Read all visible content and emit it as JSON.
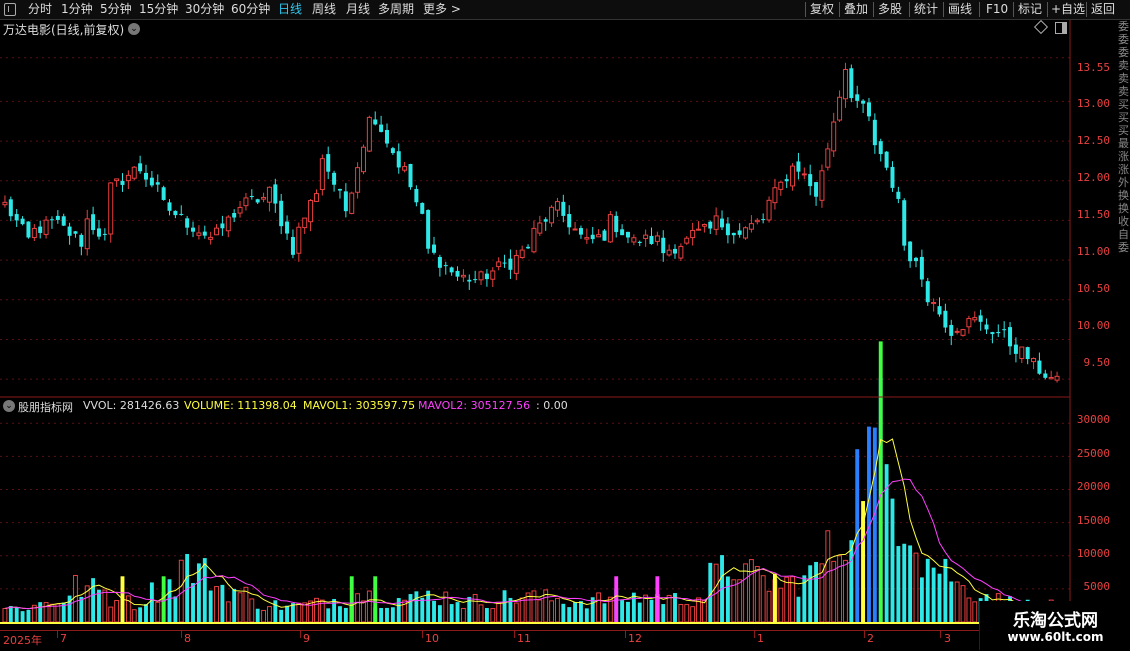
{
  "toolbar": {
    "left": [
      "分时",
      "1分钟",
      "5分钟",
      "15分钟",
      "30分钟",
      "60分钟",
      "日线",
      "周线",
      "月线",
      "多周期",
      "更多 >"
    ],
    "active": "日线",
    "right": [
      "复权",
      "叠加",
      "多股",
      "统计",
      "画线",
      "F10",
      "标记",
      "+自选",
      "返回"
    ]
  },
  "stock_title": "万达电影(日线,前复权)",
  "price_axis": [
    "13.55",
    "13.00",
    "12.50",
    "12.00",
    "11.50",
    "11.00",
    "10.50",
    "10.00",
    "9.50"
  ],
  "volume_axis": [
    "30000",
    "25000",
    "20000",
    "15000",
    "10000",
    "5000"
  ],
  "volume_header": {
    "name": "股朋指标网",
    "vvol": "VVOL: 281426.63",
    "volume": "VOLUME: 111398.04",
    "mavol1": "MAVOL1: 303597.75",
    "mavol2": "MAVOL2: 305127.56",
    "extra": ": 0.00"
  },
  "date_axis": [
    "2025年",
    "7",
    "8",
    "9",
    "10",
    "11",
    "12",
    "1",
    "2",
    "3"
  ],
  "right_strip": [
    "委",
    "委",
    "委",
    "卖",
    "卖",
    "卖",
    "买",
    "买",
    "买",
    "最",
    "涨",
    "涨",
    "外",
    "换",
    "换",
    "收",
    "自",
    "委"
  ],
  "watermark": {
    "title": "乐淘公式网",
    "url": "www.60lt.com"
  },
  "colors": {
    "up": "#e84040",
    "down": "#2ee8e8",
    "ma1": "#ffff40",
    "ma2": "#ff40ff",
    "signal_green": "#40ff40",
    "signal_yellow": "#ffff40",
    "signal_magenta": "#ff40ff",
    "highlight_blue": "#2a7fff"
  },
  "chart_data": [
    {
      "type": "candlestick",
      "title": "万达电影(日线,前复权)",
      "ylim": [
        9.3,
        13.9
      ],
      "y_ticks": [
        13.55,
        13.0,
        12.5,
        12.0,
        11.5,
        11.0,
        10.5,
        10.0,
        9.5
      ],
      "x_months": [
        "2025年",
        "7",
        "8",
        "9",
        "10",
        "11",
        "12",
        "1",
        "2",
        "3"
      ],
      "segments": [
        [
          11.7,
          11.2
        ],
        [
          11.35,
          11.5
        ],
        [
          11.45,
          11.2
        ],
        [
          11.55,
          11.2
        ],
        [
          11.9,
          12.15
        ],
        [
          12.2,
          11.8
        ],
        [
          11.7,
          11.45
        ],
        [
          11.45,
          11.25
        ],
        [
          11.3,
          11.7
        ],
        [
          11.7,
          11.8
        ],
        [
          11.9,
          11.1
        ],
        [
          11.25,
          12.0
        ],
        [
          12.35,
          11.6
        ],
        [
          11.7,
          12.95
        ],
        [
          12.85,
          12.2
        ],
        [
          12.3,
          11.4
        ],
        [
          11.15,
          10.85
        ],
        [
          10.8,
          10.75
        ],
        [
          10.75,
          10.95
        ],
        [
          10.9,
          11.2
        ],
        [
          11.3,
          11.7
        ],
        [
          11.65,
          11.25
        ],
        [
          11.2,
          11.35
        ],
        [
          11.5,
          11.2
        ],
        [
          11.25,
          11.25
        ],
        [
          11.1,
          11.25
        ],
        [
          11.3,
          11.4
        ],
        [
          11.5,
          11.3
        ],
        [
          11.35,
          11.55
        ],
        [
          11.7,
          12.2
        ],
        [
          12.25,
          11.75
        ],
        [
          12.0,
          13.5
        ],
        [
          13.2,
          12.7
        ],
        [
          12.5,
          11.75
        ],
        [
          11.3,
          10.7
        ],
        [
          10.6,
          10.1
        ],
        [
          10.15,
          10.25
        ],
        [
          10.2,
          10.05
        ],
        [
          10.0,
          9.75
        ],
        [
          9.7,
          9.45
        ]
      ]
    },
    {
      "type": "bar",
      "title": "股朋指标网",
      "ylim": [
        0,
        32000
      ],
      "y_ticks": [
        30000,
        25000,
        20000,
        15000,
        10000,
        5000
      ],
      "segments": [
        [
          2200,
          2600
        ],
        [
          3000,
          4200
        ],
        [
          5800,
          4800
        ],
        [
          3600,
          2800
        ],
        [
          4500,
          6800
        ],
        [
          9500,
          7200
        ],
        [
          6000,
          4200
        ],
        [
          3200,
          2600
        ],
        [
          2500,
          3000
        ],
        [
          3500,
          3900
        ],
        [
          4800,
          3400
        ],
        [
          3600,
          4000
        ],
        [
          4500,
          3800
        ],
        [
          3200,
          3600
        ],
        [
          3800,
          4300
        ],
        [
          4000,
          3600
        ],
        [
          3400,
          3600
        ],
        [
          3800,
          4000
        ],
        [
          4200,
          3800
        ],
        [
          3600,
          4200
        ],
        [
          6800,
          9800
        ],
        [
          8000,
          6000
        ],
        [
          5500,
          7500
        ],
        [
          8500,
          14000
        ],
        [
          20000,
          30000
        ],
        [
          25000,
          15000
        ],
        [
          11000,
          8000
        ],
        [
          6000,
          4500
        ],
        [
          3800,
          3000
        ],
        [
          2800,
          2500
        ]
      ],
      "series": [
        {
          "name": "MAVOL1"
        },
        {
          "name": "MAVOL2"
        }
      ]
    }
  ]
}
